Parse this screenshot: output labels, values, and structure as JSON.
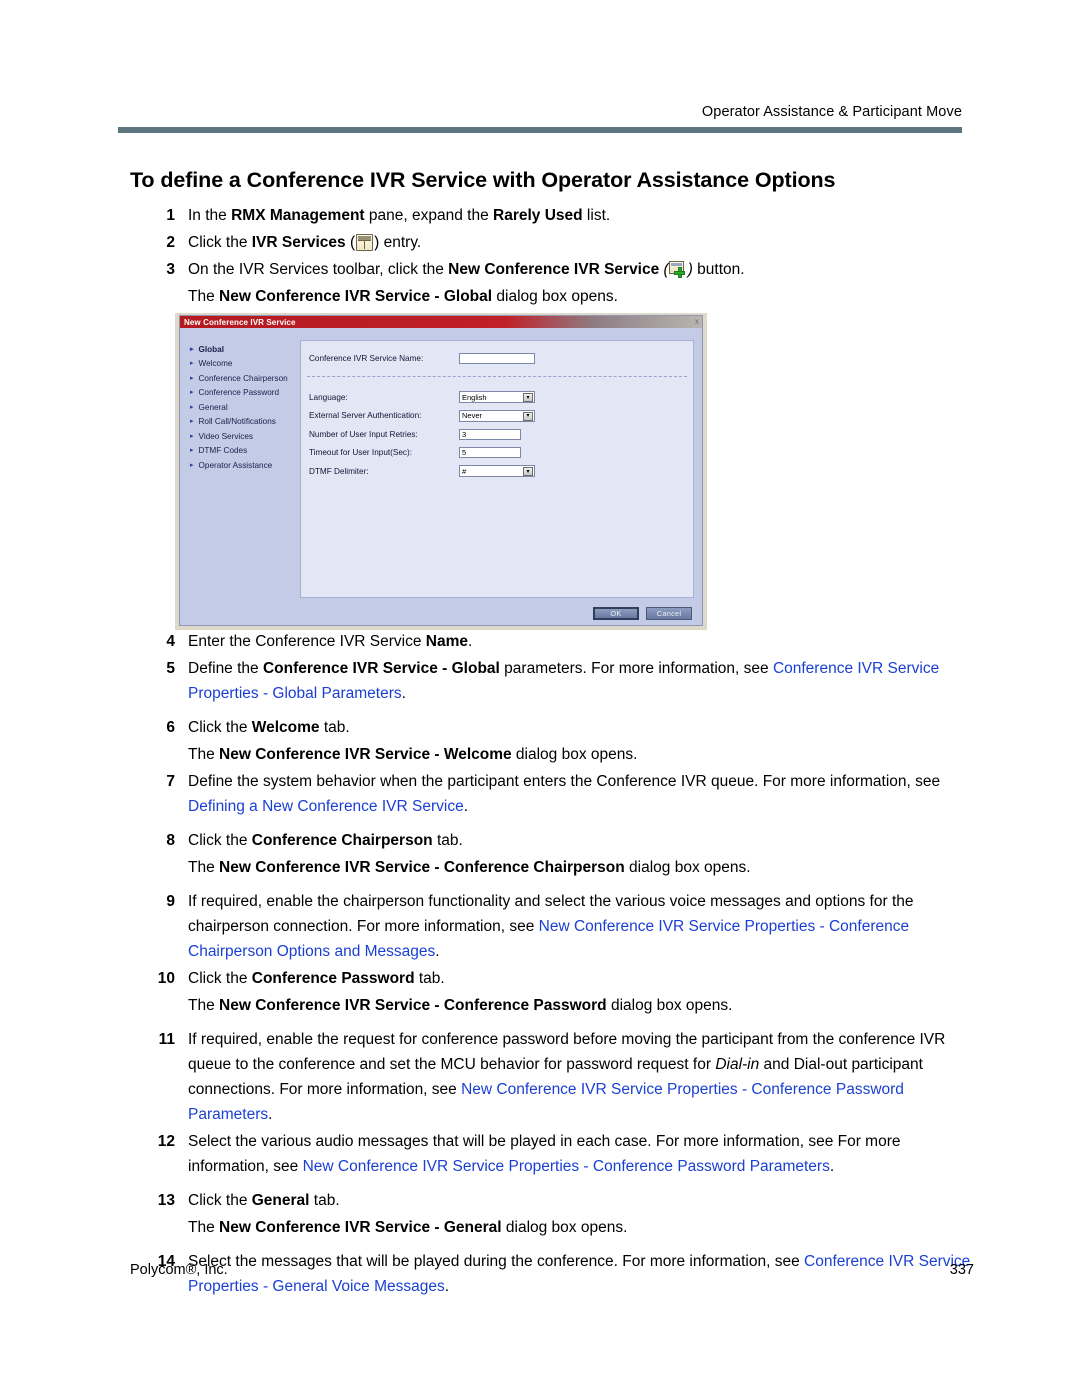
{
  "header": {
    "running_head": "Operator Assistance & Participant Move"
  },
  "title": "To define a Conference IVR Service with Operator Assistance Options",
  "steps": [
    {
      "num": "1",
      "segments": [
        {
          "t": "In the ",
          "s": "n"
        },
        {
          "t": "RMX Management",
          "s": "b"
        },
        {
          "t": " pane, expand the ",
          "s": "n"
        },
        {
          "t": "Rarely Used",
          "s": "b"
        },
        {
          "t": " list.",
          "s": "n"
        }
      ]
    },
    {
      "num": "2",
      "segments": [
        {
          "t": "Click the ",
          "s": "n"
        },
        {
          "t": "IVR Services",
          "s": "b"
        },
        {
          "t": " (",
          "s": "n"
        },
        {
          "t": "",
          "s": "icon-ivr"
        },
        {
          "t": ") entry.",
          "s": "n"
        }
      ]
    },
    {
      "num": "3",
      "segments": [
        {
          "t": "On the IVR Services toolbar, click the ",
          "s": "n"
        },
        {
          "t": "New Conference IVR Service",
          "s": "b"
        },
        {
          "t": " (",
          "s": "i"
        },
        {
          "t": "",
          "s": "icon-ivr-new"
        },
        {
          "t": ")",
          "s": "i"
        },
        {
          "t": " button.",
          "s": "n"
        }
      ]
    },
    {
      "num": "",
      "cont": true,
      "segments": [
        {
          "t": "The ",
          "s": "n"
        },
        {
          "t": "New Conference IVR Service - Global",
          "s": "b"
        },
        {
          "t": " dialog box opens.",
          "s": "n"
        }
      ]
    },
    {
      "num": "4",
      "segments": [
        {
          "t": "Enter the Conference IVR Service ",
          "s": "n"
        },
        {
          "t": "Name",
          "s": "b"
        },
        {
          "t": ".",
          "s": "n"
        }
      ]
    },
    {
      "num": "5",
      "segments": [
        {
          "t": "Define the ",
          "s": "n"
        },
        {
          "t": "Conference IVR Service - Global",
          "s": "b"
        },
        {
          "t": " parameters. For more information, see ",
          "s": "n"
        },
        {
          "t": "Conference IVR Service Properties - Global Parameters",
          "s": "link"
        },
        {
          "t": ".",
          "s": "n"
        }
      ]
    },
    {
      "num": "6",
      "segments": [
        {
          "t": "Click the ",
          "s": "n"
        },
        {
          "t": "Welcome",
          "s": "b"
        },
        {
          "t": " tab.",
          "s": "n"
        }
      ]
    },
    {
      "num": "",
      "cont": true,
      "segments": [
        {
          "t": "The ",
          "s": "n"
        },
        {
          "t": "New Conference IVR Service - Welcome",
          "s": "b"
        },
        {
          "t": " dialog box opens.",
          "s": "n"
        }
      ]
    },
    {
      "num": "7",
      "segments": [
        {
          "t": "Define the system behavior when the participant enters the Conference IVR queue. For more information, see ",
          "s": "n"
        },
        {
          "t": "Defining a New Conference IVR Service",
          "s": "link"
        },
        {
          "t": ".",
          "s": "n"
        }
      ]
    },
    {
      "num": "8",
      "segments": [
        {
          "t": "Click the ",
          "s": "n"
        },
        {
          "t": "Conference Chairperson",
          "s": "b"
        },
        {
          "t": " tab.",
          "s": "n"
        }
      ]
    },
    {
      "num": "",
      "cont": true,
      "segments": [
        {
          "t": "The ",
          "s": "n"
        },
        {
          "t": "New Conference IVR Service - Conference Chairperson",
          "s": "b"
        },
        {
          "t": " dialog box opens.",
          "s": "n"
        }
      ]
    },
    {
      "num": "9",
      "segments": [
        {
          "t": "If required, enable the chairperson functionality and select the various voice messages and options for the chairperson connection. For more information, see ",
          "s": "n"
        },
        {
          "t": "New Conference IVR Service Properties - Conference Chairperson Options and Messages",
          "s": "link"
        },
        {
          "t": ".",
          "s": "n"
        }
      ]
    },
    {
      "num": "10",
      "segments": [
        {
          "t": "Click the ",
          "s": "n"
        },
        {
          "t": "Conference Password",
          "s": "b"
        },
        {
          "t": " tab.",
          "s": "n"
        }
      ]
    },
    {
      "num": "",
      "cont": true,
      "segments": [
        {
          "t": "The ",
          "s": "n"
        },
        {
          "t": "New Conference IVR Service - Conference Password",
          "s": "b"
        },
        {
          "t": " dialog box opens.",
          "s": "n"
        }
      ]
    },
    {
      "num": "11",
      "segments": [
        {
          "t": "If required, enable the request for conference password before moving the participant from the conference IVR queue to the conference and set the MCU behavior for password request for ",
          "s": "n"
        },
        {
          "t": "Dial-in",
          "s": "i"
        },
        {
          "t": " and Dial-out participant connections. For more information, see ",
          "s": "n"
        },
        {
          "t": "New Conference IVR Service Properties - Conference Password Parameters",
          "s": "link"
        },
        {
          "t": ".",
          "s": "n"
        }
      ]
    },
    {
      "num": "12",
      "segments": [
        {
          "t": "Select the various audio messages that will be played in each case. For more information, see For more information, see ",
          "s": "n"
        },
        {
          "t": "New Conference IVR Service Properties - Conference Password Parameters",
          "s": "link"
        },
        {
          "t": ".",
          "s": "n"
        }
      ]
    },
    {
      "num": "13",
      "segments": [
        {
          "t": "Click the ",
          "s": "n"
        },
        {
          "t": "General",
          "s": "b"
        },
        {
          "t": " tab.",
          "s": "n"
        }
      ]
    },
    {
      "num": "",
      "cont": true,
      "segments": [
        {
          "t": "The ",
          "s": "n"
        },
        {
          "t": "New Conference IVR Service - General",
          "s": "b"
        },
        {
          "t": " dialog box opens.",
          "s": "n"
        }
      ]
    },
    {
      "num": "14",
      "segments": [
        {
          "t": "Select the messages that will be played during the conference. For more information, see ",
          "s": "n"
        },
        {
          "t": "Conference IVR Service Properties - General Voice Messages",
          "s": "link"
        },
        {
          "t": ".",
          "s": "n"
        }
      ]
    }
  ],
  "dialog": {
    "title": "New Conference IVR Service",
    "close_label": "x",
    "nav_items": [
      {
        "label": "Global",
        "active": true
      },
      {
        "label": "Welcome",
        "active": false
      },
      {
        "label": "Conference Chairperson",
        "active": false
      },
      {
        "label": "Conference Password",
        "active": false
      },
      {
        "label": "General",
        "active": false
      },
      {
        "label": "Roll Call/Notifications",
        "active": false
      },
      {
        "label": "Video Services",
        "active": false
      },
      {
        "label": "DTMF Codes",
        "active": false
      },
      {
        "label": "Operator Assistance",
        "active": false
      }
    ],
    "name_field": {
      "label": "Conference IVR Service Name:",
      "value": ""
    },
    "fields": [
      {
        "label": "Language:",
        "value": "English",
        "type": "combo"
      },
      {
        "label": "External Server Authentication:",
        "value": "Never",
        "type": "combo"
      },
      {
        "label": "Number of User Input Retries:",
        "value": "3",
        "type": "text"
      },
      {
        "label": "Timeout for User Input(Sec):",
        "value": "5",
        "type": "text"
      },
      {
        "label": "DTMF Delimiter:",
        "value": "#",
        "type": "combo"
      }
    ],
    "buttons": {
      "ok": "OK",
      "cancel": "Cancel"
    }
  },
  "footer": {
    "company": "Polycom®, Inc.",
    "page_number": "337"
  },
  "colors": {
    "link": "#1a3fd4",
    "rule": "#5e7480",
    "dialog_titlebar": "#b51a20",
    "dialog_bg": "#c3cbe6"
  }
}
